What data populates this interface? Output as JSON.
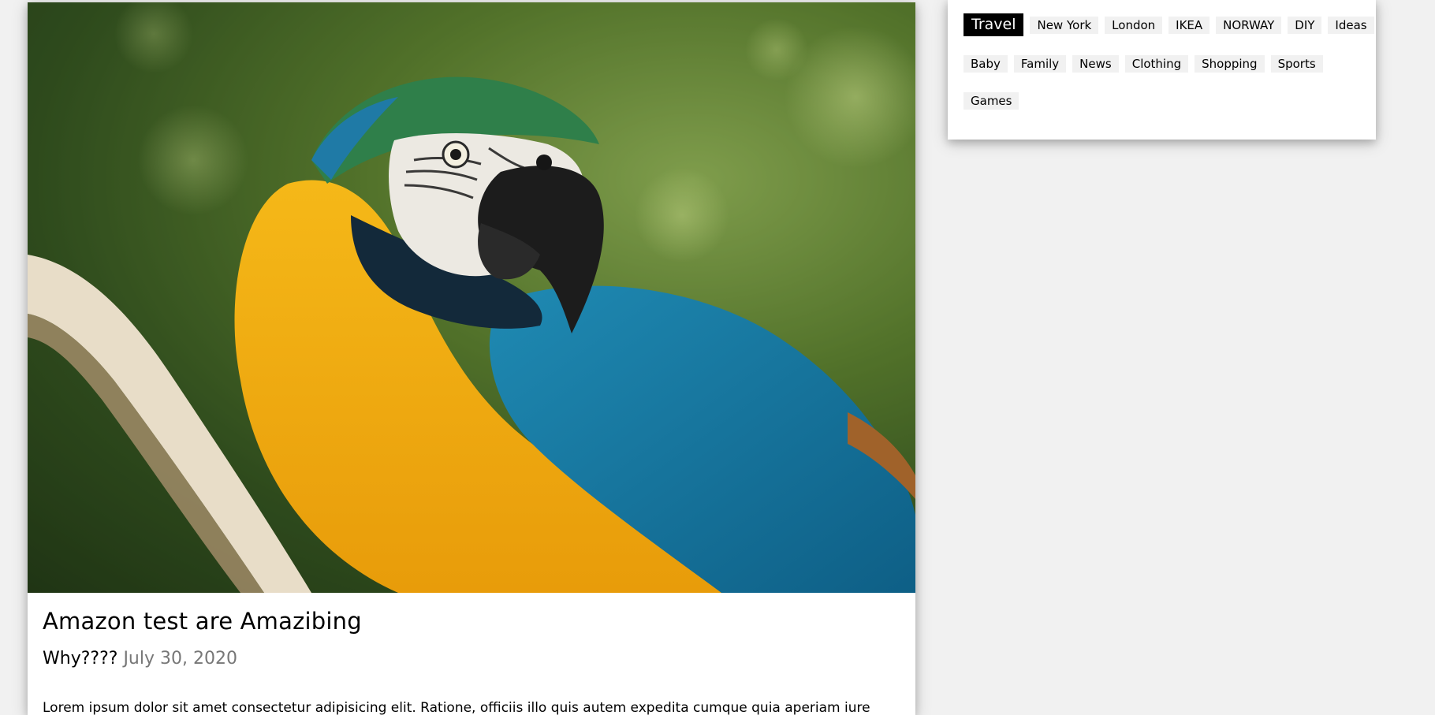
{
  "post": {
    "title": "Amazon test are Amazibing",
    "subtitle": "Why????",
    "date": "July 30, 2020",
    "excerpt": "Lorem ipsum dolor sit amet consectetur adipisicing elit. Ratione, officiis illo quis autem expedita cumque quia aperiam iure",
    "image_subject": "blue-and-yellow macaw parrot perched on a branch"
  },
  "tags": {
    "active": "Travel",
    "row1": [
      "Travel",
      "New York",
      "London",
      "IKEA",
      "NORWAY",
      "DIY",
      "Ideas"
    ],
    "row2": [
      "Baby",
      "Family",
      "News",
      "Clothing",
      "Shopping",
      "Sports"
    ],
    "row3": [
      "Games"
    ]
  },
  "colors": {
    "page_bg": "#f1f1f1",
    "card_bg": "#ffffff",
    "tag_bg": "#f1f1f1",
    "tag_active_bg": "#000000",
    "tag_active_text": "#ffffff",
    "date_text": "#777777"
  }
}
